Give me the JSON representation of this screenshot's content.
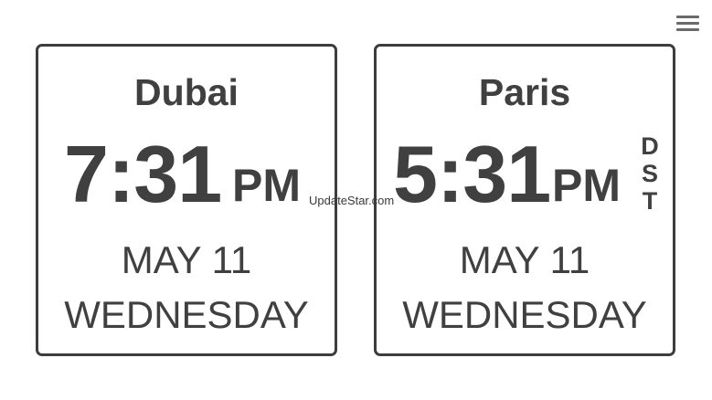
{
  "menu": {
    "icon": "hamburger-menu-icon"
  },
  "clocks": [
    {
      "city": "Dubai",
      "time": "7:31",
      "ampm": "PM",
      "date": "MAY 11",
      "weekday": "WEDNESDAY",
      "dst": ""
    },
    {
      "city": "Paris",
      "time": "5:31",
      "ampm": "PM",
      "date": "MAY 11",
      "weekday": "WEDNESDAY",
      "dst": "DST"
    }
  ],
  "dst_letters": [
    "D",
    "S",
    "T"
  ],
  "watermark": "UpdateStar.com",
  "colors": {
    "text": "#404040",
    "border": "#3d3d3d",
    "background": "#ffffff"
  }
}
